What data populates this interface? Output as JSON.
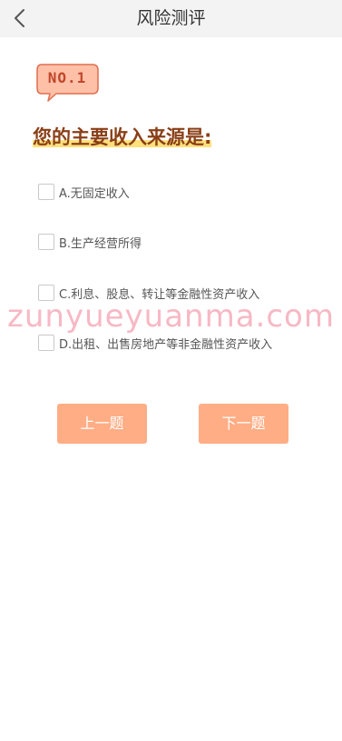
{
  "header": {
    "title": "风险测评",
    "back_icon": "chevron-left-icon"
  },
  "question": {
    "badge": "NO.1",
    "text": "您的主要收入来源是:"
  },
  "options": [
    {
      "label": "A.无固定收入",
      "checked": false
    },
    {
      "label": "B.生产经营所得",
      "checked": false
    },
    {
      "label": "C.利息、股息、转让等金融性资产收入",
      "checked": false
    },
    {
      "label": "D.出租、出售房地产等非金融性资产收入",
      "checked": false
    }
  ],
  "watermark": "zunyueyuanma.com",
  "buttons": {
    "prev": "上一题",
    "next": "下一题"
  },
  "colors": {
    "header_bg": "#f3f3f3",
    "badge_bg": "#ffc0a8",
    "badge_border": "#e06f4f",
    "question_text": "#8a3f17",
    "question_highlight": "#ffe07a",
    "button_bg": "#ffad85",
    "watermark": "#f28ca0"
  }
}
